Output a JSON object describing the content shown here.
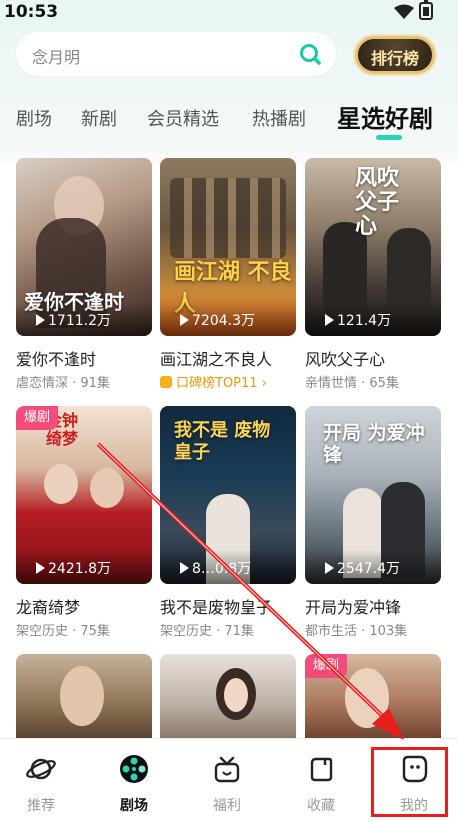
{
  "status_bar": {
    "time": "10:53"
  },
  "search": {
    "placeholder": "念月明"
  },
  "ranking_button": {
    "label": "排行榜"
  },
  "tabs": [
    {
      "label": "剧场"
    },
    {
      "label": "新剧"
    },
    {
      "label": "会员精选"
    },
    {
      "label": "热播剧"
    },
    {
      "label_a": "星选",
      "label_b": "好剧",
      "active": true
    }
  ],
  "cards": [
    {
      "title": "爱你不逢时",
      "subtitle": "虐恋情深 · 91集",
      "plays": "1711.2万",
      "poster_text": "爱你不逢时"
    },
    {
      "title": "画江湖之不良人",
      "subtitle": "口碑榜TOP11",
      "plays": "7204.3万",
      "poster_text": "画江湖 不良人"
    },
    {
      "title": "风吹父子心",
      "subtitle": "亲情世情 · 65集",
      "plays": "121.4万",
      "poster_text": "风吹父子心"
    },
    {
      "title": "龙裔绮梦",
      "subtitle": "架空历史 · 75集",
      "plays": "2421.8万",
      "badge": "爆剧",
      "poster_text": "金钟 绮梦"
    },
    {
      "title": "我不是废物皇子",
      "subtitle": "架空历史 · 71集",
      "plays": "8…0.8万",
      "poster_text": "我不是 废物皇子"
    },
    {
      "title": "开局为爱冲锋",
      "subtitle": "都市生活 · 103集",
      "plays": "2547.4万",
      "poster_text": "开局 为爱冲锋"
    },
    {
      "badge": "爆剧"
    }
  ],
  "bottom_nav": [
    {
      "label": "推荐",
      "icon": "planet-icon"
    },
    {
      "label": "剧场",
      "icon": "film-reel-icon",
      "active": true
    },
    {
      "label": "福利",
      "icon": "gift-icon"
    },
    {
      "label": "收藏",
      "icon": "bookmark-icon"
    },
    {
      "label": "我的",
      "icon": "profile-icon"
    }
  ],
  "colors": {
    "accent": "#2bd3b9",
    "badge": "#f24c7a",
    "highlight_annotation": "#e61e1e"
  }
}
